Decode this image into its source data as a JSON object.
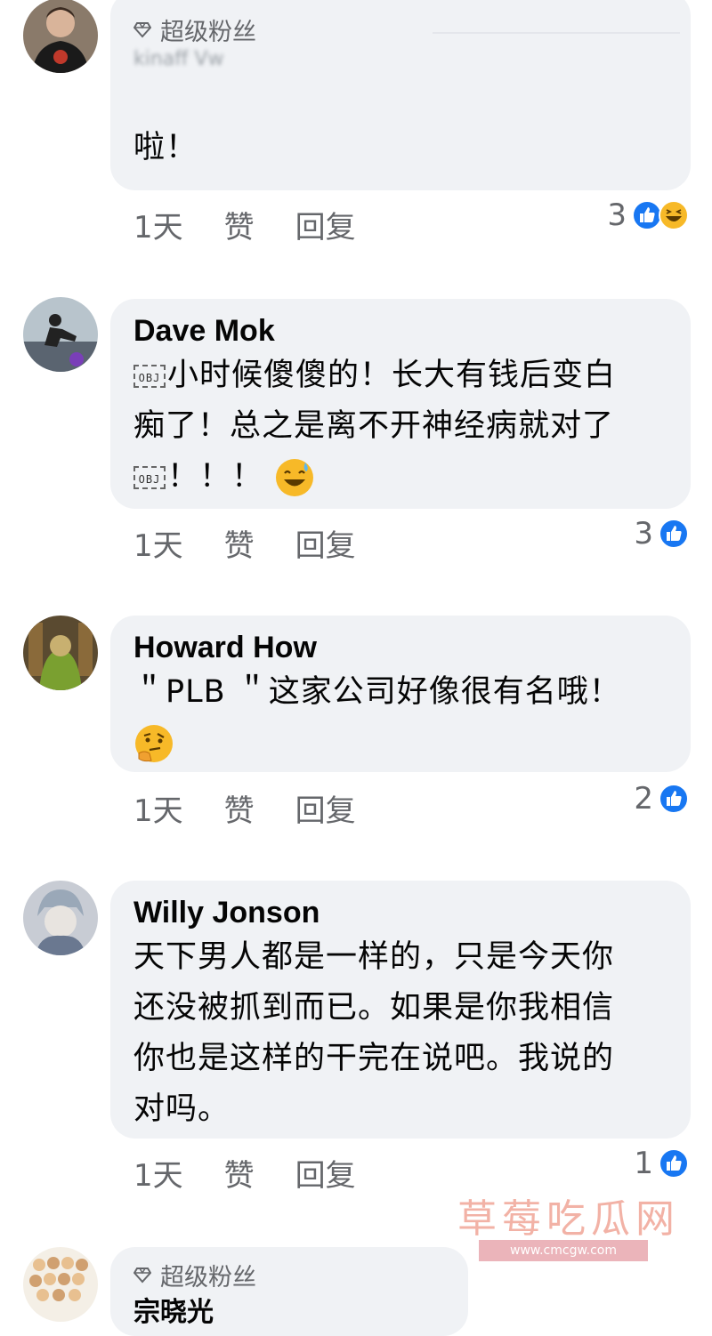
{
  "comments": [
    {
      "badge": "超级粉丝",
      "blurred_name": "kinaff Vw",
      "text": "啦！",
      "time": "1天",
      "like_label": "赞",
      "reply_label": "回复",
      "reaction_count": "3",
      "reactions": [
        "like-icon",
        "haha-icon"
      ]
    },
    {
      "name": "Dave Mok",
      "obj_label": "OBJ",
      "line1": "小时候傻傻的！长大有钱后变白",
      "line2": "痴了！总之是离不开神经病就对了",
      "line3": "！！！",
      "time": "1天",
      "like_label": "赞",
      "reply_label": "回复",
      "reaction_count": "3",
      "reactions": [
        "like-icon"
      ]
    },
    {
      "name": "Howard How",
      "line1": "＂PLB ＂这家公司好像很有名哦！",
      "time": "1天",
      "like_label": "赞",
      "reply_label": "回复",
      "reaction_count": "2",
      "reactions": [
        "like-icon"
      ]
    },
    {
      "name": "Willy Jonson",
      "line1": "天下男人都是一样的，只是今天你",
      "line2": "还没被抓到而已。如果是你我相信",
      "line3": "你也是这样的干完在说吧。我说的",
      "line4": "对吗。",
      "time": "1天",
      "like_label": "赞",
      "reply_label": "回复",
      "reaction_count": "1",
      "reactions": [
        "like-icon"
      ]
    },
    {
      "badge": "超级粉丝",
      "partial_name": "宗晓光"
    }
  ],
  "watermark": {
    "text": "草莓吃瓜网",
    "url": "www.cmcgw.com"
  },
  "colors": {
    "bubble": "#f0f2f5",
    "like_blue": "#1877f2",
    "meta_gray": "#65676b"
  }
}
